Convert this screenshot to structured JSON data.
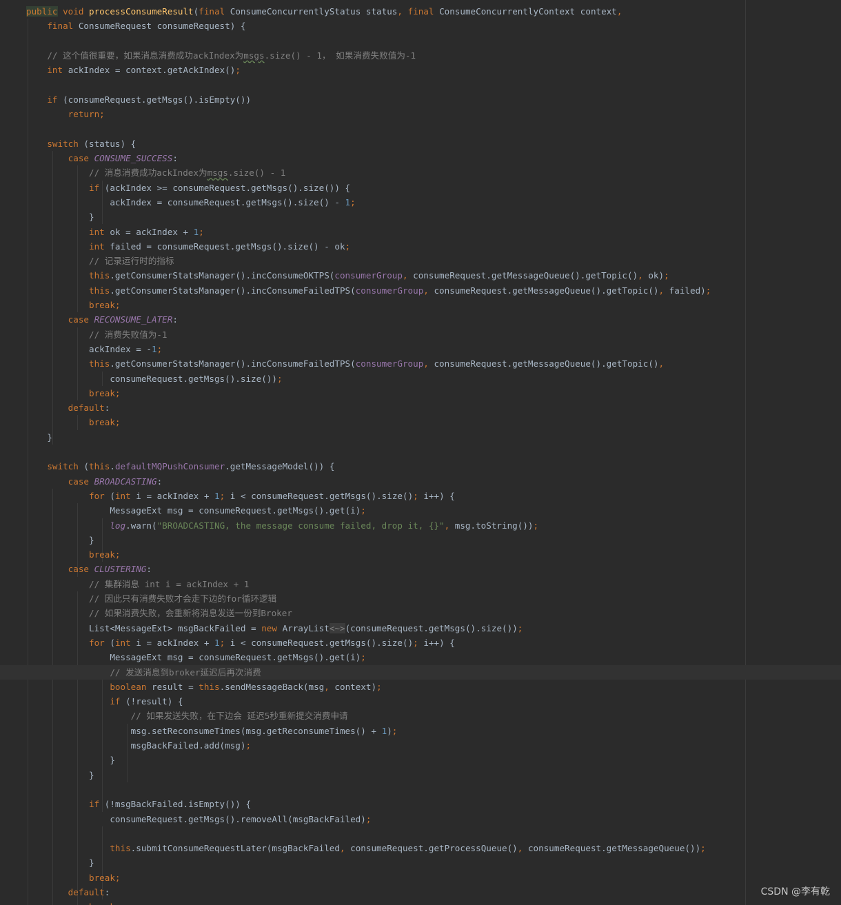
{
  "watermark": "CSDN @李有乾",
  "code_lines": [
    {
      "segments": [
        {
          "t": "public",
          "c": "kw hl"
        },
        {
          "t": " void ",
          "c": "kw"
        },
        {
          "t": "processConsumeResult",
          "c": "fn"
        },
        {
          "t": "(",
          "c": ""
        },
        {
          "t": "final ",
          "c": "kw"
        },
        {
          "t": "ConsumeConcurrentlyStatus status",
          "c": ""
        },
        {
          "t": ", ",
          "c": "kw"
        },
        {
          "t": "final ",
          "c": "kw"
        },
        {
          "t": "ConsumeConcurrentlyContext context",
          "c": ""
        },
        {
          "t": ",",
          "c": "kw"
        }
      ]
    },
    {
      "segments": [
        {
          "t": "    ",
          "c": ""
        },
        {
          "t": "final ",
          "c": "kw"
        },
        {
          "t": "ConsumeRequest consumeRequest) {",
          "c": ""
        }
      ]
    },
    {
      "segments": []
    },
    {
      "segments": [
        {
          "t": "    ",
          "c": ""
        },
        {
          "t": "// 这个值很重要，如果消息消费成功ackIndex为",
          "c": "cm"
        },
        {
          "t": "msgs",
          "c": "cm squig"
        },
        {
          "t": ".size() - 1， 如果消费失败值为-1",
          "c": "cm"
        }
      ]
    },
    {
      "segments": [
        {
          "t": "    ",
          "c": ""
        },
        {
          "t": "int ",
          "c": "kw"
        },
        {
          "t": "ackIndex = context.getAckIndex()",
          "c": ""
        },
        {
          "t": ";",
          "c": "kw"
        }
      ]
    },
    {
      "segments": []
    },
    {
      "segments": [
        {
          "t": "    ",
          "c": ""
        },
        {
          "t": "if ",
          "c": "kw"
        },
        {
          "t": "(consumeRequest.getMsgs().isEmpty())",
          "c": ""
        }
      ]
    },
    {
      "segments": [
        {
          "t": "        ",
          "c": ""
        },
        {
          "t": "return;",
          "c": "kw"
        }
      ]
    },
    {
      "segments": []
    },
    {
      "segments": [
        {
          "t": "    ",
          "c": ""
        },
        {
          "t": "switch ",
          "c": "kw"
        },
        {
          "t": "(status) {",
          "c": ""
        }
      ]
    },
    {
      "segments": [
        {
          "t": "        ",
          "c": ""
        },
        {
          "t": "case ",
          "c": "kw"
        },
        {
          "t": "CONSUME_SUCCESS",
          "c": "const"
        },
        {
          "t": ":",
          "c": ""
        }
      ]
    },
    {
      "segments": [
        {
          "t": "            ",
          "c": ""
        },
        {
          "t": "// 消息消费成功ackIndex为",
          "c": "cm"
        },
        {
          "t": "msgs",
          "c": "cm squig"
        },
        {
          "t": ".size() - 1",
          "c": "cm"
        }
      ]
    },
    {
      "segments": [
        {
          "t": "            ",
          "c": ""
        },
        {
          "t": "if ",
          "c": "kw"
        },
        {
          "t": "(ackIndex >= consumeRequest.getMsgs().size()) {",
          "c": ""
        }
      ]
    },
    {
      "segments": [
        {
          "t": "                ",
          "c": ""
        },
        {
          "t": "ackIndex = consumeRequest.getMsgs().size() - ",
          "c": ""
        },
        {
          "t": "1",
          "c": "num"
        },
        {
          "t": ";",
          "c": "kw"
        }
      ]
    },
    {
      "segments": [
        {
          "t": "            }",
          "c": ""
        }
      ]
    },
    {
      "segments": [
        {
          "t": "            ",
          "c": ""
        },
        {
          "t": "int ",
          "c": "kw"
        },
        {
          "t": "ok = ackIndex + ",
          "c": ""
        },
        {
          "t": "1",
          "c": "num"
        },
        {
          "t": ";",
          "c": "kw"
        }
      ]
    },
    {
      "segments": [
        {
          "t": "            ",
          "c": ""
        },
        {
          "t": "int ",
          "c": "kw"
        },
        {
          "t": "failed = consumeRequest.getMsgs().size() - ok",
          "c": ""
        },
        {
          "t": ";",
          "c": "kw"
        }
      ]
    },
    {
      "segments": [
        {
          "t": "            ",
          "c": ""
        },
        {
          "t": "// 记录运行时的指标",
          "c": "cm"
        }
      ]
    },
    {
      "segments": [
        {
          "t": "            ",
          "c": ""
        },
        {
          "t": "this",
          "c": "kw"
        },
        {
          "t": ".getConsumerStatsManager().incConsumeOKTPS(",
          "c": ""
        },
        {
          "t": "consumerGroup",
          "c": "fld"
        },
        {
          "t": ", ",
          "c": "kw"
        },
        {
          "t": "consumeRequest.getMessageQueue().getTopic()",
          "c": ""
        },
        {
          "t": ", ",
          "c": "kw"
        },
        {
          "t": "ok)",
          "c": ""
        },
        {
          "t": ";",
          "c": "kw"
        }
      ]
    },
    {
      "segments": [
        {
          "t": "            ",
          "c": ""
        },
        {
          "t": "this",
          "c": "kw"
        },
        {
          "t": ".getConsumerStatsManager().incConsumeFailedTPS(",
          "c": ""
        },
        {
          "t": "consumerGroup",
          "c": "fld"
        },
        {
          "t": ", ",
          "c": "kw"
        },
        {
          "t": "consumeRequest.getMessageQueue().getTopic()",
          "c": ""
        },
        {
          "t": ", ",
          "c": "kw"
        },
        {
          "t": "failed)",
          "c": ""
        },
        {
          "t": ";",
          "c": "kw"
        }
      ]
    },
    {
      "segments": [
        {
          "t": "            ",
          "c": ""
        },
        {
          "t": "break;",
          "c": "kw"
        }
      ]
    },
    {
      "segments": [
        {
          "t": "        ",
          "c": ""
        },
        {
          "t": "case ",
          "c": "kw"
        },
        {
          "t": "RECONSUME_LATER",
          "c": "const"
        },
        {
          "t": ":",
          "c": ""
        }
      ]
    },
    {
      "segments": [
        {
          "t": "            ",
          "c": ""
        },
        {
          "t": "// 消费失败值为-1",
          "c": "cm"
        }
      ]
    },
    {
      "segments": [
        {
          "t": "            ",
          "c": ""
        },
        {
          "t": "ackIndex = -",
          "c": ""
        },
        {
          "t": "1",
          "c": "num"
        },
        {
          "t": ";",
          "c": "kw"
        }
      ]
    },
    {
      "segments": [
        {
          "t": "            ",
          "c": ""
        },
        {
          "t": "this",
          "c": "kw"
        },
        {
          "t": ".getConsumerStatsManager().incConsumeFailedTPS(",
          "c": ""
        },
        {
          "t": "consumerGroup",
          "c": "fld"
        },
        {
          "t": ", ",
          "c": "kw"
        },
        {
          "t": "consumeRequest.getMessageQueue().getTopic()",
          "c": ""
        },
        {
          "t": ",",
          "c": "kw"
        }
      ]
    },
    {
      "segments": [
        {
          "t": "                ",
          "c": ""
        },
        {
          "t": "consumeRequest.getMsgs().size())",
          "c": ""
        },
        {
          "t": ";",
          "c": "kw"
        }
      ]
    },
    {
      "segments": [
        {
          "t": "            ",
          "c": ""
        },
        {
          "t": "break;",
          "c": "kw"
        }
      ]
    },
    {
      "segments": [
        {
          "t": "        ",
          "c": ""
        },
        {
          "t": "default",
          "c": "kw"
        },
        {
          "t": ":",
          "c": ""
        }
      ]
    },
    {
      "segments": [
        {
          "t": "            ",
          "c": ""
        },
        {
          "t": "break;",
          "c": "kw"
        }
      ]
    },
    {
      "segments": [
        {
          "t": "    }",
          "c": ""
        }
      ]
    },
    {
      "segments": []
    },
    {
      "segments": [
        {
          "t": "    ",
          "c": ""
        },
        {
          "t": "switch ",
          "c": "kw"
        },
        {
          "t": "(",
          "c": ""
        },
        {
          "t": "this",
          "c": "kw"
        },
        {
          "t": ".",
          "c": ""
        },
        {
          "t": "defaultMQPushConsumer",
          "c": "fld"
        },
        {
          "t": ".getMessageModel()) {",
          "c": ""
        }
      ]
    },
    {
      "segments": [
        {
          "t": "        ",
          "c": ""
        },
        {
          "t": "case ",
          "c": "kw"
        },
        {
          "t": "BROADCASTING",
          "c": "const"
        },
        {
          "t": ":",
          "c": ""
        }
      ]
    },
    {
      "segments": [
        {
          "t": "            ",
          "c": ""
        },
        {
          "t": "for ",
          "c": "kw"
        },
        {
          "t": "(",
          "c": ""
        },
        {
          "t": "int ",
          "c": "kw"
        },
        {
          "t": "i = ackIndex + ",
          "c": ""
        },
        {
          "t": "1",
          "c": "num"
        },
        {
          "t": "; ",
          "c": "kw"
        },
        {
          "t": "i < consumeRequest.getMsgs().size()",
          "c": ""
        },
        {
          "t": "; ",
          "c": "kw"
        },
        {
          "t": "i++) {",
          "c": ""
        }
      ]
    },
    {
      "segments": [
        {
          "t": "                ",
          "c": ""
        },
        {
          "t": "MessageExt msg = consumeRequest.getMsgs().get(i)",
          "c": ""
        },
        {
          "t": ";",
          "c": "kw"
        }
      ]
    },
    {
      "segments": [
        {
          "t": "                ",
          "c": ""
        },
        {
          "t": "log",
          "c": "ilog"
        },
        {
          "t": ".warn(",
          "c": ""
        },
        {
          "t": "\"BROADCASTING, the message consume failed, drop it, {}\"",
          "c": "str"
        },
        {
          "t": ", ",
          "c": "kw"
        },
        {
          "t": "msg.toString())",
          "c": ""
        },
        {
          "t": ";",
          "c": "kw"
        }
      ]
    },
    {
      "segments": [
        {
          "t": "            }",
          "c": ""
        }
      ]
    },
    {
      "segments": [
        {
          "t": "            ",
          "c": ""
        },
        {
          "t": "break;",
          "c": "kw"
        }
      ]
    },
    {
      "segments": [
        {
          "t": "        ",
          "c": ""
        },
        {
          "t": "case ",
          "c": "kw"
        },
        {
          "t": "CLUSTERING",
          "c": "const"
        },
        {
          "t": ":",
          "c": ""
        }
      ]
    },
    {
      "segments": [
        {
          "t": "            ",
          "c": ""
        },
        {
          "t": "// 集群消息 int i = ackIndex + 1",
          "c": "cm"
        }
      ]
    },
    {
      "segments": [
        {
          "t": "            ",
          "c": ""
        },
        {
          "t": "// 因此只有消费失败才会走下边的for循环逻辑",
          "c": "cm"
        }
      ]
    },
    {
      "segments": [
        {
          "t": "            ",
          "c": ""
        },
        {
          "t": "// 如果消费失败，会重新将消息发送一份到Broker",
          "c": "cm"
        }
      ]
    },
    {
      "segments": [
        {
          "t": "            ",
          "c": ""
        },
        {
          "t": "List<MessageExt> msgBackFailed = ",
          "c": ""
        },
        {
          "t": "new ",
          "c": "kw"
        },
        {
          "t": "ArrayList",
          "c": ""
        },
        {
          "t": "<~>",
          "c": "cm diamond"
        },
        {
          "t": "(consumeRequest.getMsgs().size())",
          "c": ""
        },
        {
          "t": ";",
          "c": "kw"
        }
      ]
    },
    {
      "segments": [
        {
          "t": "            ",
          "c": ""
        },
        {
          "t": "for ",
          "c": "kw"
        },
        {
          "t": "(",
          "c": ""
        },
        {
          "t": "int ",
          "c": "kw"
        },
        {
          "t": "i = ackIndex + ",
          "c": ""
        },
        {
          "t": "1",
          "c": "num"
        },
        {
          "t": "; ",
          "c": "kw"
        },
        {
          "t": "i < consumeRequest.getMsgs().size()",
          "c": ""
        },
        {
          "t": "; ",
          "c": "kw"
        },
        {
          "t": "i++) {",
          "c": ""
        }
      ]
    },
    {
      "segments": [
        {
          "t": "                ",
          "c": ""
        },
        {
          "t": "MessageExt msg = consumeRequest.getMsgs().get(i)",
          "c": ""
        },
        {
          "t": ";",
          "c": "kw"
        }
      ]
    },
    {
      "segments": [
        {
          "t": "                ",
          "c": ""
        },
        {
          "t": "// 发送消息到broker延迟后再次消费",
          "c": "cm"
        }
      ]
    },
    {
      "segments": [
        {
          "t": "                ",
          "c": ""
        },
        {
          "t": "boolean ",
          "c": "kw"
        },
        {
          "t": "result = ",
          "c": ""
        },
        {
          "t": "this",
          "c": "kw"
        },
        {
          "t": ".sendMessageBack(msg",
          "c": ""
        },
        {
          "t": ", ",
          "c": "kw"
        },
        {
          "t": "context)",
          "c": ""
        },
        {
          "t": ";",
          "c": "kw"
        }
      ]
    },
    {
      "segments": [
        {
          "t": "                ",
          "c": ""
        },
        {
          "t": "if ",
          "c": "kw"
        },
        {
          "t": "(!result) {",
          "c": ""
        }
      ]
    },
    {
      "segments": [
        {
          "t": "                    ",
          "c": ""
        },
        {
          "t": "// 如果发送失败，在下边会 延迟5秒重新提交消费申请",
          "c": "cm"
        }
      ]
    },
    {
      "segments": [
        {
          "t": "                    ",
          "c": ""
        },
        {
          "t": "msg.setReconsumeTimes(msg.getReconsumeTimes() + ",
          "c": ""
        },
        {
          "t": "1",
          "c": "num"
        },
        {
          "t": ")",
          "c": ""
        },
        {
          "t": ";",
          "c": "kw"
        }
      ]
    },
    {
      "segments": [
        {
          "t": "                    ",
          "c": ""
        },
        {
          "t": "msgBackFailed.add(msg)",
          "c": ""
        },
        {
          "t": ";",
          "c": "kw"
        }
      ]
    },
    {
      "segments": [
        {
          "t": "                }",
          "c": ""
        }
      ]
    },
    {
      "segments": [
        {
          "t": "            }",
          "c": ""
        }
      ]
    },
    {
      "segments": []
    },
    {
      "segments": [
        {
          "t": "            ",
          "c": ""
        },
        {
          "t": "if ",
          "c": "kw"
        },
        {
          "t": "(!msgBackFailed.isEmpty()) {",
          "c": ""
        }
      ]
    },
    {
      "segments": [
        {
          "t": "                ",
          "c": ""
        },
        {
          "t": "consumeRequest.getMsgs().removeAll(msgBackFailed)",
          "c": ""
        },
        {
          "t": ";",
          "c": "kw"
        }
      ]
    },
    {
      "segments": []
    },
    {
      "segments": [
        {
          "t": "                ",
          "c": ""
        },
        {
          "t": "this",
          "c": "kw"
        },
        {
          "t": ".submitConsumeRequestLater(msgBackFailed",
          "c": ""
        },
        {
          "t": ", ",
          "c": "kw"
        },
        {
          "t": "consumeRequest.getProcessQueue()",
          "c": ""
        },
        {
          "t": ", ",
          "c": "kw"
        },
        {
          "t": "consumeRequest.getMessageQueue())",
          "c": ""
        },
        {
          "t": ";",
          "c": "kw"
        }
      ]
    },
    {
      "segments": [
        {
          "t": "            }",
          "c": ""
        }
      ]
    },
    {
      "segments": [
        {
          "t": "            ",
          "c": ""
        },
        {
          "t": "break;",
          "c": "kw"
        }
      ]
    },
    {
      "segments": [
        {
          "t": "        ",
          "c": ""
        },
        {
          "t": "default",
          "c": "kw"
        },
        {
          "t": ":",
          "c": ""
        }
      ]
    },
    {
      "segments": [
        {
          "t": "            ",
          "c": ""
        },
        {
          "t": "break;",
          "c": "kw"
        }
      ]
    }
  ]
}
